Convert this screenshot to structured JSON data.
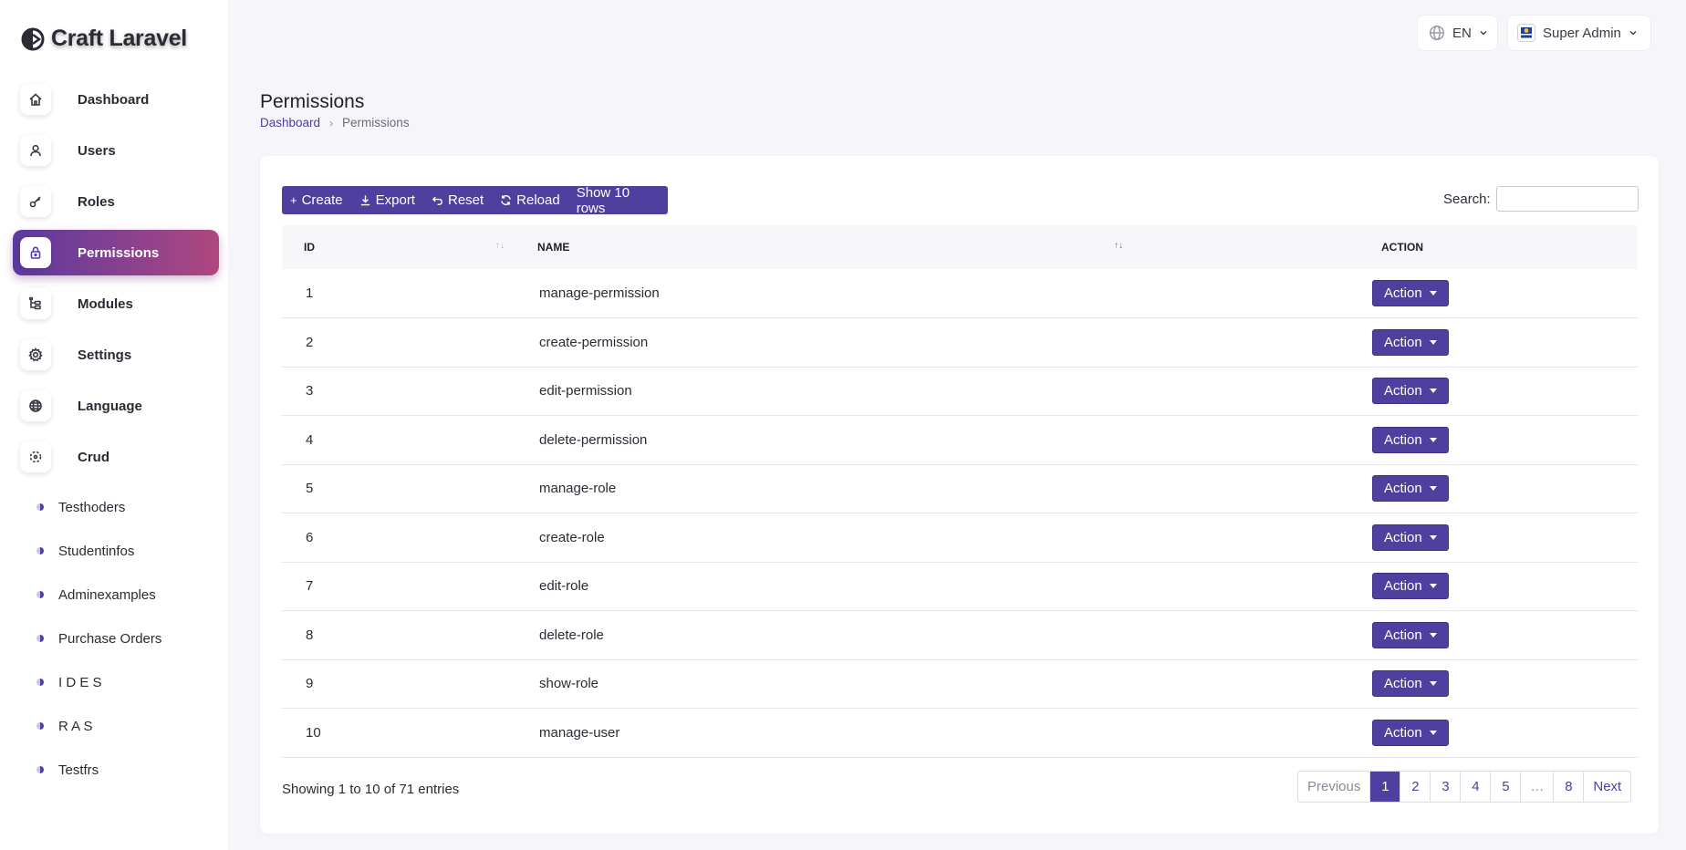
{
  "brand": {
    "name": "Craft Laravel"
  },
  "sidebar": {
    "items": [
      {
        "label": "Dashboard",
        "icon": "home-icon"
      },
      {
        "label": "Users",
        "icon": "user-icon"
      },
      {
        "label": "Roles",
        "icon": "key-icon"
      },
      {
        "label": "Permissions",
        "icon": "lock-icon",
        "active": true
      },
      {
        "label": "Modules",
        "icon": "tree-icon"
      },
      {
        "label": "Settings",
        "icon": "gear-icon"
      },
      {
        "label": "Language",
        "icon": "globe-icon"
      },
      {
        "label": "Crud",
        "icon": "crud-icon"
      }
    ],
    "subitems": [
      "Testhoders",
      "Studentinfos",
      "Adminexamples",
      "Purchase Orders",
      "I D E S",
      "R A S",
      "Testfrs"
    ]
  },
  "topbar": {
    "language": "EN",
    "user": "Super Admin"
  },
  "page": {
    "title": "Permissions",
    "breadcrumb": {
      "home": "Dashboard",
      "current": "Permissions"
    }
  },
  "toolbar": {
    "create": "Create",
    "export": "Export",
    "reset": "Reset",
    "reload": "Reload",
    "rows": "Show 10 rows"
  },
  "search": {
    "label": "Search:",
    "value": ""
  },
  "table": {
    "columns": {
      "id": "ID",
      "name": "NAME",
      "action": "ACTION"
    },
    "action_label": "Action",
    "rows": [
      {
        "id": "1",
        "name": "manage-permission"
      },
      {
        "id": "2",
        "name": "create-permission"
      },
      {
        "id": "3",
        "name": "edit-permission"
      },
      {
        "id": "4",
        "name": "delete-permission"
      },
      {
        "id": "5",
        "name": "manage-role"
      },
      {
        "id": "6",
        "name": "create-role"
      },
      {
        "id": "7",
        "name": "edit-role"
      },
      {
        "id": "8",
        "name": "delete-role"
      },
      {
        "id": "9",
        "name": "show-role"
      },
      {
        "id": "10",
        "name": "manage-user"
      }
    ]
  },
  "pagination": {
    "info": "Showing 1 to 10 of 71 entries",
    "previous": "Previous",
    "pages": [
      "1",
      "2",
      "3",
      "4",
      "5",
      "…",
      "8"
    ],
    "active_page": "1",
    "next": "Next"
  },
  "colors": {
    "primary": "#4f3f9e",
    "gradient_start": "#5a3aa0",
    "gradient_end": "#b0477f"
  }
}
